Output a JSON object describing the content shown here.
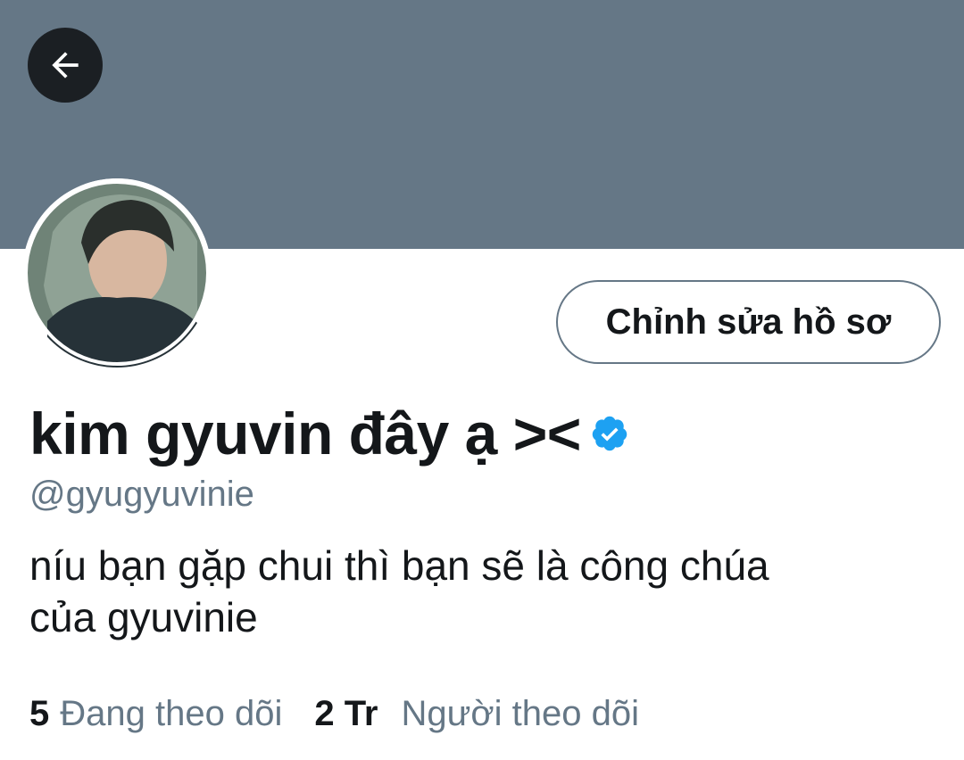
{
  "profile": {
    "display_name": "kim gyuvin đây ạ ><",
    "handle": "@gyugyuvinie",
    "bio_line1": "níu bạn gặp chui thì bạn sẽ là công chúa",
    "bio_line2": "của gyuvinie",
    "verified": true
  },
  "header": {
    "back_icon": "arrow-left-icon",
    "banner_color": "#657786"
  },
  "actions": {
    "edit_profile_label": "Chỉnh sửa hồ sơ"
  },
  "stats": {
    "following_count": "5",
    "following_label": "Đang theo dõi",
    "followers_count": "2 Tr",
    "followers_label": "Người theo dõi"
  },
  "colors": {
    "text_primary": "#14171a",
    "text_secondary": "#657786",
    "verified_blue": "#1da1f2",
    "back_button_bg": "#1b1f23"
  }
}
